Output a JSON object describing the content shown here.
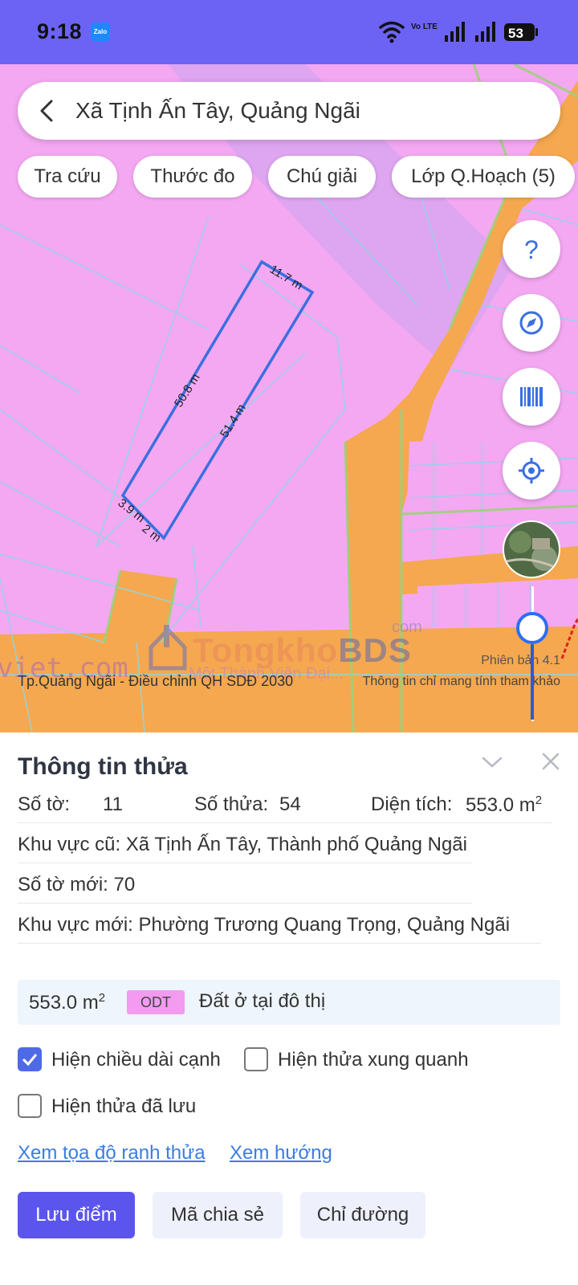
{
  "status_bar": {
    "time": "9:18",
    "zalo_label": "Zalo",
    "network_label": "Vo LTE",
    "battery": "53"
  },
  "search": {
    "location": "Xã Tịnh Ấn Tây, Quảng Ngãi"
  },
  "chips": [
    {
      "label": "Tra cứu"
    },
    {
      "label": "Thước đo"
    },
    {
      "label": "Chú giải"
    },
    {
      "label": "Lớp Q.Hoạch (5)"
    }
  ],
  "fabs": [
    "help-icon",
    "compass-icon",
    "barcode-icon",
    "locate-icon",
    "satellite-thumbnail"
  ],
  "map": {
    "edge_labels": [
      "11.7 m",
      "50.8 m",
      "51.4 m",
      "3.9 m",
      "2 m"
    ],
    "watermark_com": "com",
    "watermark_brand_a": "Tongkho",
    "watermark_brand_b": "BDS",
    "watermark_sub": "Một Thành Viên Đại...",
    "watermark_left": "viet.com",
    "version": "Phiên bản 4.1",
    "caption_left": "Tp.Quảng Ngãi - Điều chỉnh QH SDĐ 2030",
    "caption_right": "Thông tin chỉ mang tính tham khảo",
    "colors": {
      "residential": "#f4a8f2",
      "road": "#f5a84f",
      "parcel_outline": "#3b6fe0"
    }
  },
  "sheet": {
    "title": "Thông tin thửa",
    "so_to_label": "Số tờ:",
    "so_to_value": "11",
    "so_thua_label": "Số thửa:",
    "so_thua_value": "54",
    "dien_tich_label": "Diện tích:",
    "dien_tich_value": "553.0 m",
    "dien_tich_unit_sup": "2",
    "khu_vuc_cu": "Khu vực cũ: Xã Tịnh Ấn Tây, Thành phố Quảng Ngãi",
    "so_to_moi": "Số tờ mới: 70",
    "khu_vuc_moi": "Khu vực mới: Phường Trương Quang Trọng, Quảng Ngãi",
    "land_area": "553.0 m",
    "land_area_sup": "2",
    "land_code": "ODT",
    "land_desc": "Đất ở tại đô thị",
    "options": [
      {
        "label": "Hiện chiều dài cạnh",
        "checked": true
      },
      {
        "label": "Hiện thửa xung quanh",
        "checked": false
      },
      {
        "label": "Hiện thửa đã lưu",
        "checked": false
      }
    ],
    "links": {
      "coords": "Xem tọa độ ranh thửa",
      "direction": "Xem hướng"
    },
    "buttons": {
      "save": "Lưu điểm",
      "share": "Mã chia sẻ",
      "route": "Chỉ đường"
    },
    "accent": "#5b55ee"
  }
}
